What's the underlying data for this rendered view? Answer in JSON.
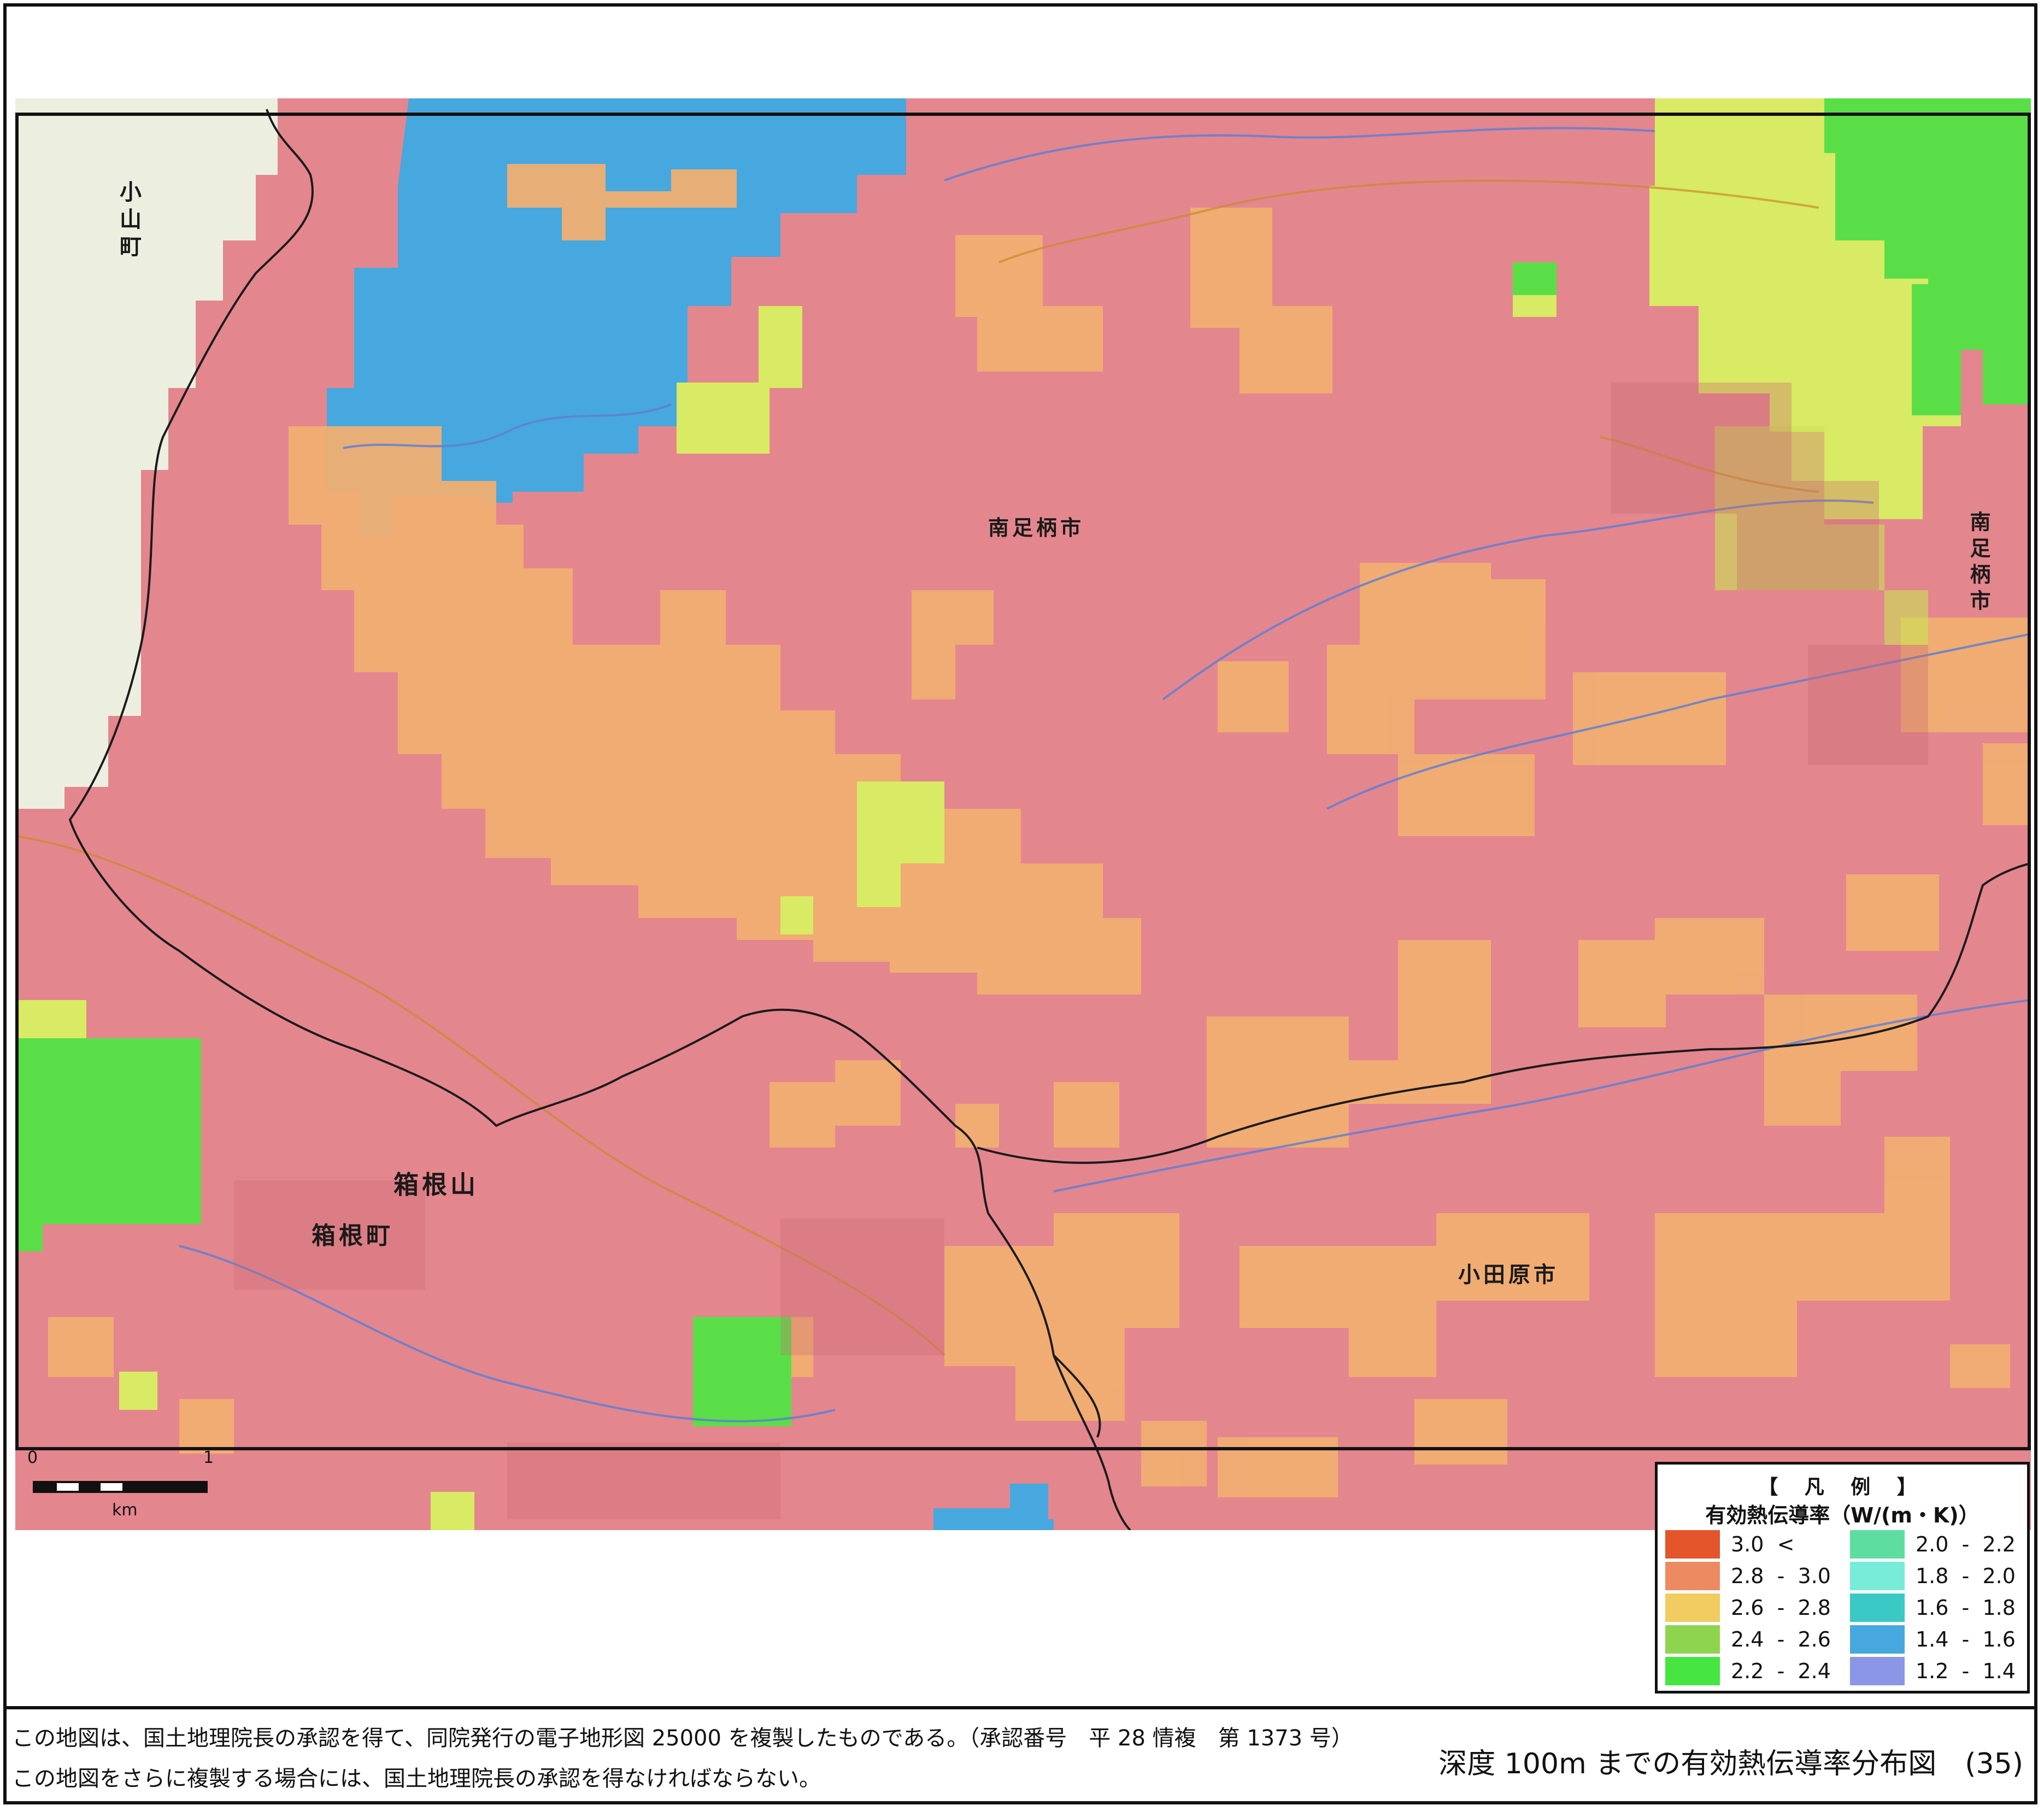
{
  "map": {
    "place_labels": {
      "oyama": "小山町",
      "minamiashigara_center": "南足柄市",
      "minamiashigara_edge": "南足柄市",
      "hakoneyama": "箱根山",
      "hakonemachi": "箱根町",
      "odawara": "小田原市"
    },
    "conductivity_colors": {
      "over_3_0": "#e4552b",
      "c2_8_3_0": "#ec8b61",
      "c2_6_2_8": "#f1cc60",
      "c2_4_2_6": "#8fd44f",
      "c2_2_2_4": "#46e541",
      "c2_0_2_2": "#5ddea0",
      "c1_8_2_0": "#78ecd8",
      "c1_6_1_8": "#3ac9c4",
      "c1_4_1_6": "#46a8de",
      "c1_2_1_4": "#8b96e6",
      "base_map": "#e4868e",
      "outside_zone": "#ecefe0"
    }
  },
  "scalebar": {
    "start_label": "0",
    "end_label": "1",
    "unit_label": "km"
  },
  "legend": {
    "title": "【 凡 例 】",
    "subtitle": "有効熱伝導率（W/(m・K)）",
    "items": [
      {
        "range": "3.0  <",
        "color": "#e4552b"
      },
      {
        "range": "2.8  -  3.0",
        "color": "#ec8b61"
      },
      {
        "range": "2.6  -  2.8",
        "color": "#f1cc60"
      },
      {
        "range": "2.4  -  2.6",
        "color": "#8fd44f"
      },
      {
        "range": "2.2  -  2.4",
        "color": "#46e541"
      },
      {
        "range": "2.0  -  2.2",
        "color": "#5ddea0"
      },
      {
        "range": "1.8  -  2.0",
        "color": "#78ecd8"
      },
      {
        "range": "1.6  -  1.8",
        "color": "#3ac9c4"
      },
      {
        "range": "1.4  -  1.6",
        "color": "#46a8de"
      },
      {
        "range": "1.2  -  1.4",
        "color": "#8b96e6"
      }
    ]
  },
  "footer": {
    "note_line1": "この地図は、国土地理院長の承認を得て、同院発行の電子地形図 25000 を複製したものである。（承認番号　平 28 情複　第 1373 号）",
    "note_line2": "この地図をさらに複製する場合には、国土地理院長の承認を得なければならない。",
    "map_title": "深度 100m までの有効熱伝導率分布図　(35)"
  }
}
